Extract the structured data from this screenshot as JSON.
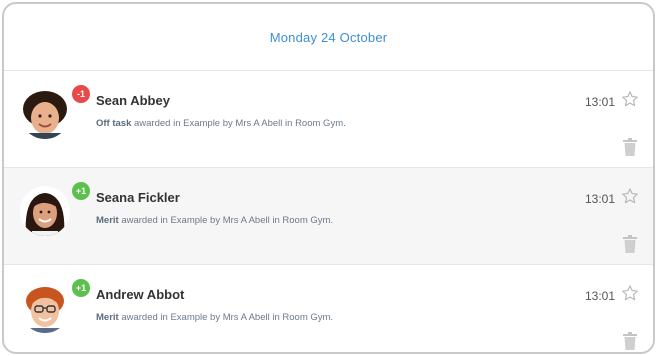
{
  "feed": {
    "date_heading": "Monday 24 October",
    "items": [
      {
        "badge": "-1",
        "badge_color": "#e84a4a",
        "name": "Sean Abbey",
        "behaviour": "Off task",
        "detail": " awarded in Example by Mrs A Abell in Room Gym.",
        "time": "13:01",
        "icons": [
          "star-outline-icon",
          "trash-icon"
        ]
      },
      {
        "badge": "+1",
        "badge_color": "#5cc04d",
        "name": "Seana Fickler",
        "behaviour": "Merit",
        "detail": " awarded in Example by Mrs A Abell in Room Gym.",
        "time": "13:01",
        "icons": [
          "star-outline-icon",
          "trash-icon"
        ]
      },
      {
        "badge": "+1",
        "badge_color": "#5cc04d",
        "name": "Andrew Abbot",
        "behaviour": "Merit",
        "detail": " awarded in Example by Mrs A Abell in Room Gym.",
        "time": "13:01",
        "icons": [
          "star-outline-icon",
          "trash-icon"
        ]
      }
    ]
  },
  "colors": {
    "accent_blue": "#3d8fd6",
    "negative_red": "#e84a4a",
    "positive_green": "#5cc04d"
  }
}
